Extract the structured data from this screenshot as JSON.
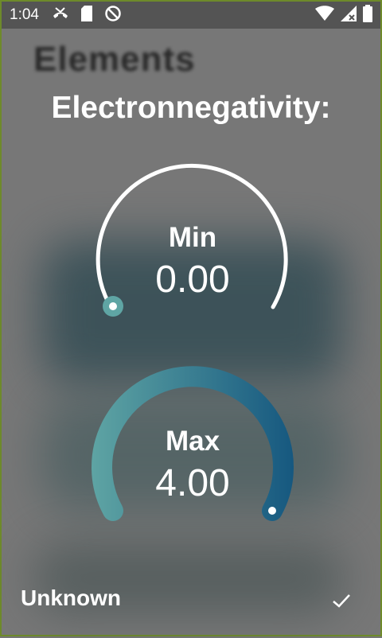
{
  "status_bar": {
    "time": "1:04",
    "icons_left": [
      "missed-call-icon",
      "sd-card-icon",
      "do-not-disturb-icon"
    ],
    "icons_right": [
      "wifi-icon",
      "cellular-no-signal-icon",
      "battery-icon"
    ]
  },
  "background": {
    "header_text": "Elements"
  },
  "dialog": {
    "title": "Electronnegativity:",
    "min": {
      "label": "Min",
      "value": "0.00",
      "fraction": 0.0
    },
    "max": {
      "label": "Max",
      "value": "4.00",
      "fraction": 1.0
    },
    "unknown_label": "Unknown",
    "confirm_icon": "checkmark-icon"
  },
  "colors": {
    "accent_start": "#5fa5a4",
    "accent_end": "#15577f",
    "track": "#ffffff",
    "scrim": "#777777"
  }
}
